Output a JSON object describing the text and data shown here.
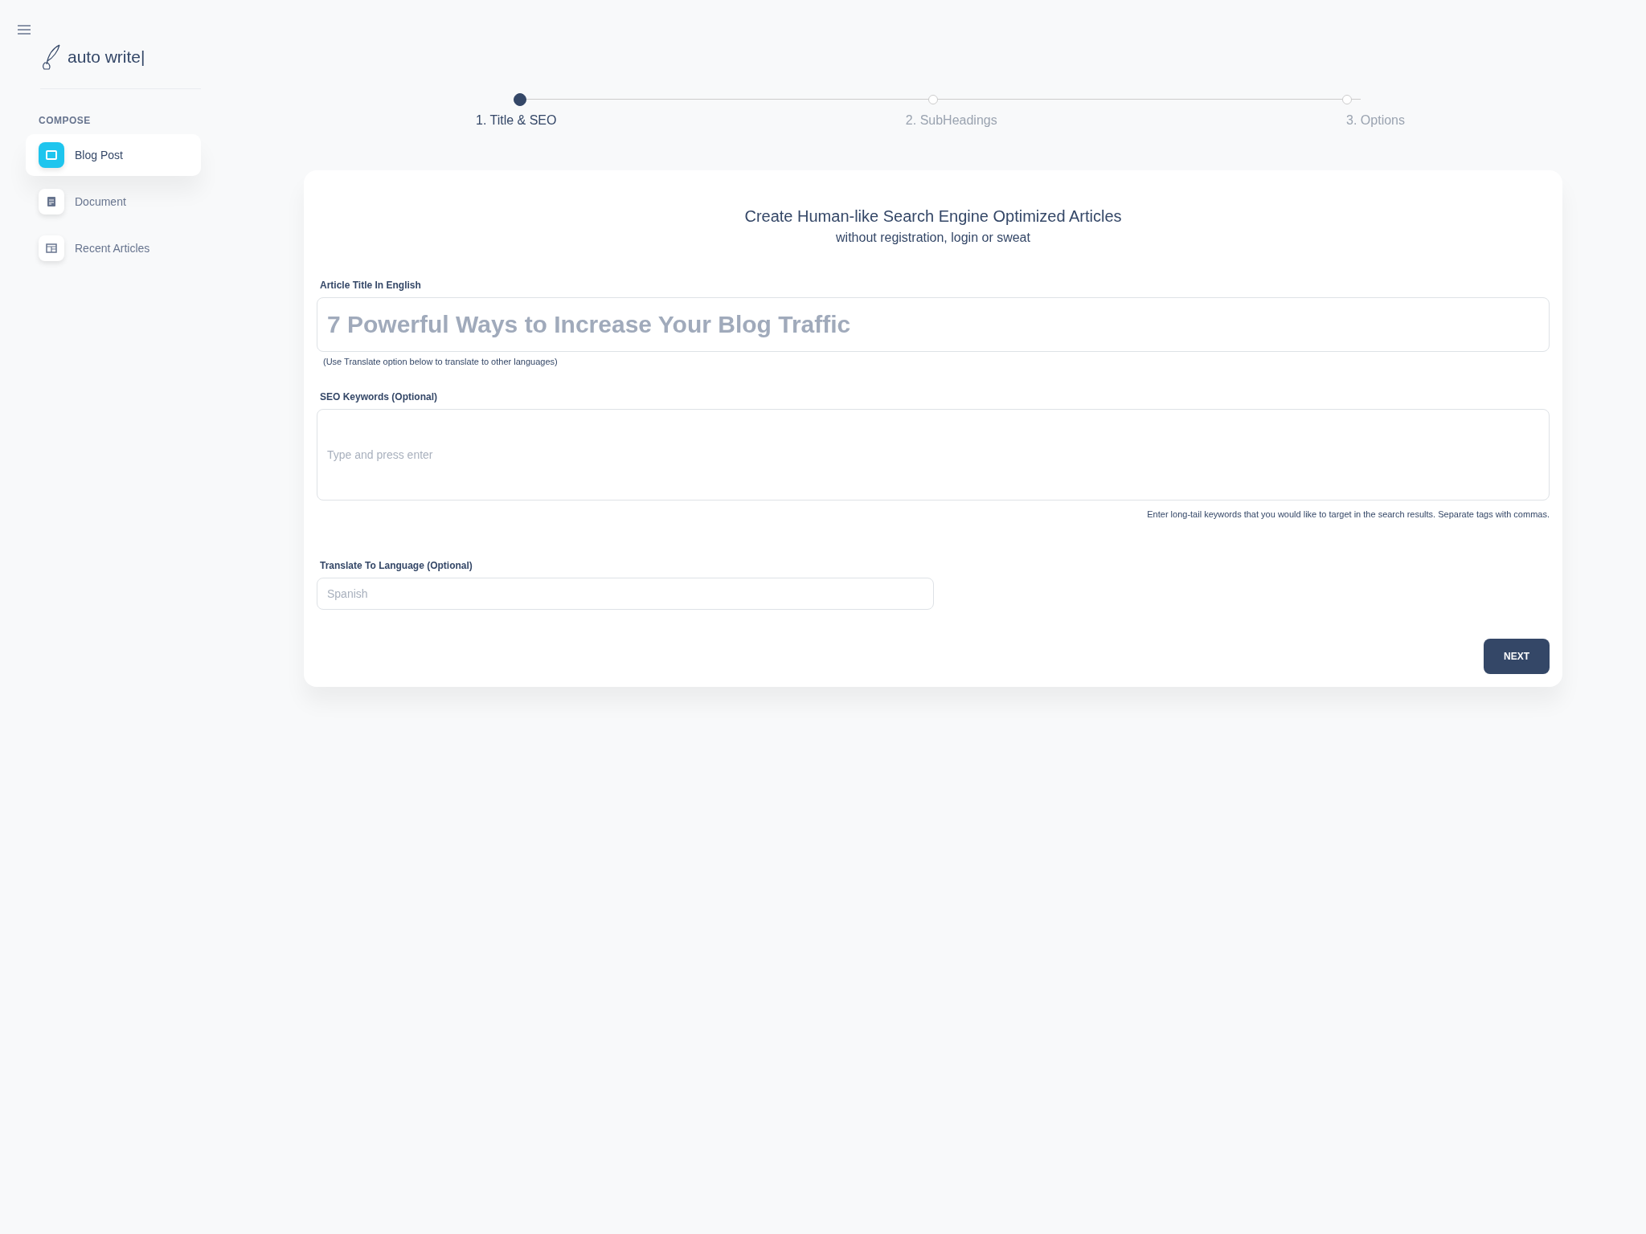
{
  "brand": {
    "name": "auto write|"
  },
  "sidebar": {
    "section": "COMPOSE",
    "items": [
      {
        "label": "Blog Post",
        "selected": true
      },
      {
        "label": "Document",
        "selected": false
      },
      {
        "label": "Recent Articles",
        "selected": false
      }
    ]
  },
  "steps": [
    {
      "label": "1. Title & SEO",
      "selected": true
    },
    {
      "label": "2. SubHeadings",
      "selected": false
    },
    {
      "label": "3. Options",
      "selected": false
    }
  ],
  "form": {
    "heading": "Create Human-like Search Engine Optimized Articles",
    "subheading": "without registration, login or sweat",
    "title_field": {
      "label": "Article Title In English",
      "placeholder": "7 Powerful Ways to Increase Your Blog Traffic",
      "help": "(Use Translate option below to translate to other languages)"
    },
    "keywords_field": {
      "label": "SEO Keywords (Optional)",
      "placeholder": "Type and press enter",
      "help": "Enter long-tail keywords that you would like to target in the search results. Separate tags with commas."
    },
    "language_field": {
      "label": "Translate To Language (Optional)",
      "placeholder": "Spanish"
    },
    "next_button": "NEXT"
  }
}
